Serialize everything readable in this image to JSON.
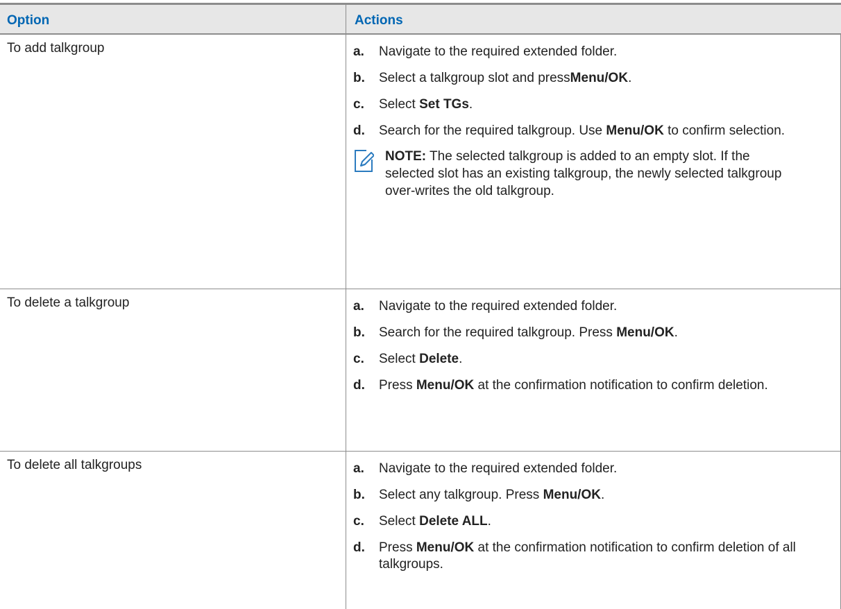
{
  "table": {
    "header": {
      "option": "Option",
      "actions": "Actions"
    },
    "rows": [
      {
        "option": "To add talkgroup",
        "steps": [
          {
            "letter": "a.",
            "segments": [
              {
                "t": "Navigate to the required extended folder."
              }
            ]
          },
          {
            "letter": "b.",
            "segments": [
              {
                "t": "Select a talkgroup slot and press"
              },
              {
                "t": "Menu/OK",
                "b": true
              },
              {
                "t": "."
              }
            ]
          },
          {
            "letter": "c.",
            "segments": [
              {
                "t": "Select "
              },
              {
                "t": "Set TGs",
                "b": true
              },
              {
                "t": "."
              }
            ]
          },
          {
            "letter": "d.",
            "segments": [
              {
                "t": "Search for the required talkgroup. Use "
              },
              {
                "t": "Menu/OK",
                "b": true
              },
              {
                "t": " to confirm selection."
              }
            ]
          }
        ],
        "note": {
          "label": "NOTE:",
          "text": " The selected talkgroup is added to an empty slot. If the selected slot has an existing talkgroup, the newly selected talkgroup over-writes the old talkgroup.",
          "icon": "note-edit-icon"
        }
      },
      {
        "option": "To delete a talkgroup",
        "steps": [
          {
            "letter": "a.",
            "segments": [
              {
                "t": "Navigate to the required extended folder."
              }
            ]
          },
          {
            "letter": "b.",
            "segments": [
              {
                "t": "Search for the required talkgroup. Press "
              },
              {
                "t": "Menu/OK",
                "b": true
              },
              {
                "t": "."
              }
            ]
          },
          {
            "letter": "c.",
            "segments": [
              {
                "t": "Select "
              },
              {
                "t": "Delete",
                "b": true
              },
              {
                "t": "."
              }
            ]
          },
          {
            "letter": "d.",
            "segments": [
              {
                "t": "Press "
              },
              {
                "t": "Menu/OK",
                "b": true
              },
              {
                "t": " at the confirmation notification to confirm deletion."
              }
            ]
          }
        ]
      },
      {
        "option": "To delete all talkgroups",
        "steps": [
          {
            "letter": "a.",
            "segments": [
              {
                "t": "Navigate to the required extended folder."
              }
            ]
          },
          {
            "letter": "b.",
            "segments": [
              {
                "t": "Select any talkgroup. Press "
              },
              {
                "t": "Menu/OK",
                "b": true
              },
              {
                "t": "."
              }
            ]
          },
          {
            "letter": "c.",
            "segments": [
              {
                "t": "Select "
              },
              {
                "t": "Delete ALL",
                "b": true
              },
              {
                "t": "."
              }
            ]
          },
          {
            "letter": "d.",
            "segments": [
              {
                "t": "Press "
              },
              {
                "t": "Menu/OK",
                "b": true
              },
              {
                "t": " at the confirmation notification to confirm deletion of all talkgroups."
              }
            ]
          }
        ]
      }
    ],
    "colors": {
      "header_text": "#0066b3",
      "header_bg": "#e7e7e7",
      "rule": "#8c8c8c",
      "note_icon": "#2b7bbf"
    }
  }
}
